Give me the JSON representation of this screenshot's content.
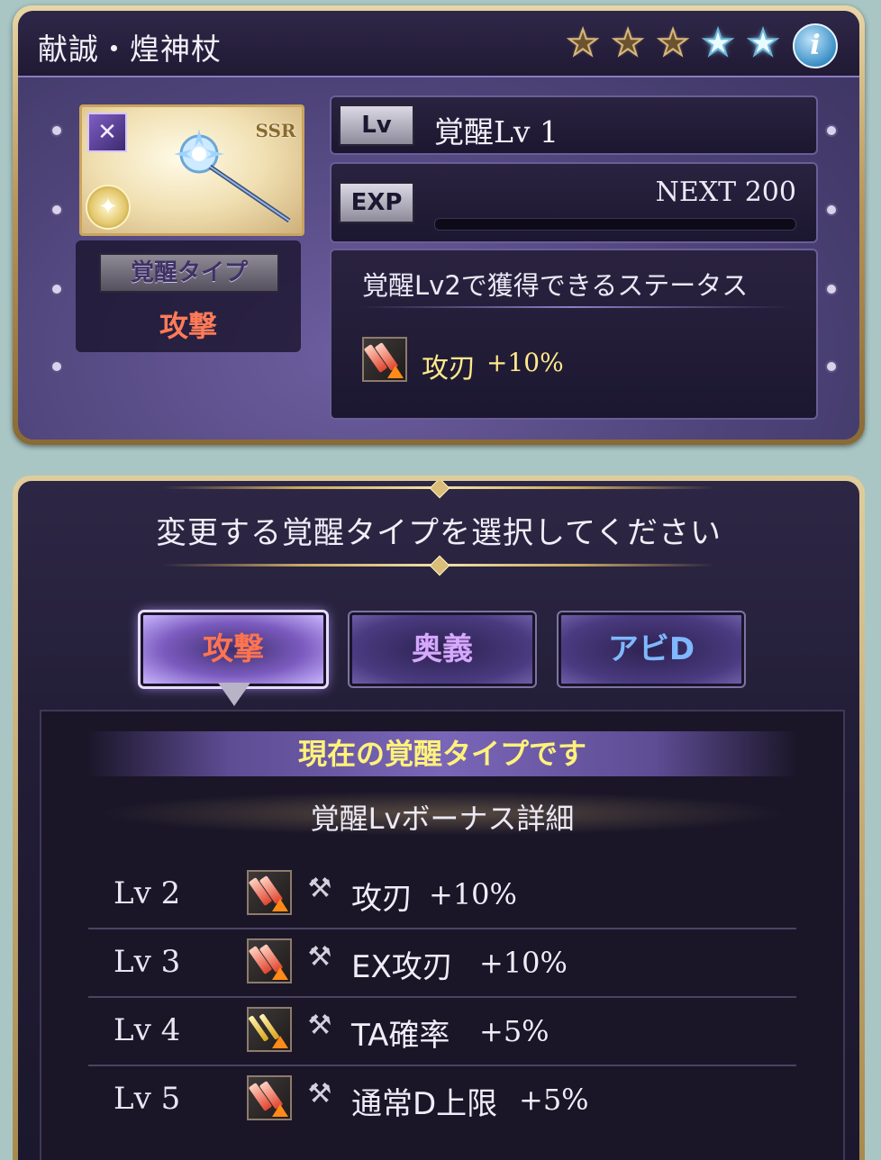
{
  "weapon": {
    "title": "献誠・煌神杖",
    "rarity_badge": "SSR",
    "stars": [
      "bronze",
      "bronze",
      "bronze",
      "blue",
      "blue"
    ],
    "info_icon": "info-icon",
    "awakening_type_label": "覚醒タイプ",
    "awakening_type_value": "攻撃",
    "lv_tag": "Lv",
    "lv_text": "覚醒Lv 1",
    "exp_tag": "EXP",
    "next_text": "NEXT 200",
    "exp_progress": 0
  },
  "next_status": {
    "title": "覚醒Lv2で獲得できるステータス",
    "name": "攻刃",
    "value": "+10%"
  },
  "selection": {
    "title": "変更する覚醒タイプを選択してください",
    "buttons": [
      {
        "label": "攻撃",
        "active": true
      },
      {
        "label": "奥義",
        "active": false
      },
      {
        "label": "アビD",
        "active": false
      }
    ],
    "current_banner": "現在の覚醒タイプです",
    "bonus_title": "覚醒Lvボーナス詳細",
    "rows": [
      {
        "lv": "Lv 2",
        "name": "攻刃",
        "value": "+10%",
        "icon": "attack-blade-icon"
      },
      {
        "lv": "Lv 3",
        "name": "EX攻刃",
        "value": "+10%",
        "icon": "attack-blade-icon"
      },
      {
        "lv": "Lv 4",
        "name": "TA確率",
        "value": "+5%",
        "icon": "triple-attack-icon"
      },
      {
        "lv": "Lv 5",
        "name": "通常D上限",
        "value": "+5%",
        "icon": "attack-blade-icon"
      }
    ]
  },
  "colors": {
    "accent_attack": "#ff7450",
    "accent_ougi": "#d6a8ff",
    "accent_abid": "#7fb8ff",
    "highlight_yellow": "#fff27a"
  }
}
